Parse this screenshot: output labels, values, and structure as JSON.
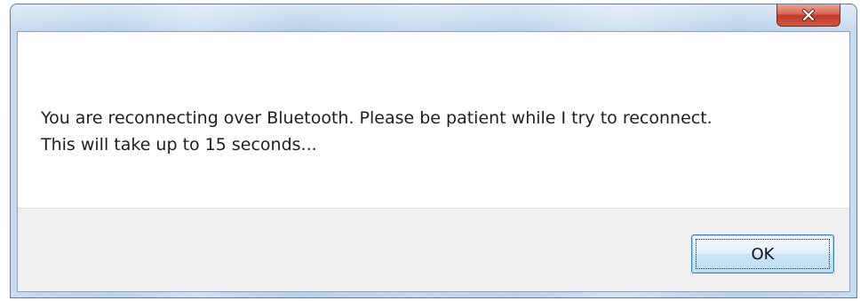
{
  "dialog": {
    "message_line1": "You are reconnecting over Bluetooth. Please be patient while I try to reconnect.",
    "message_line2": "This will take up to 15 seconds...",
    "ok_label": "OK"
  },
  "titlebar": {
    "close_icon": "close-icon"
  },
  "colors": {
    "close_button": "#c9402f",
    "ok_border": "#3c7fb1",
    "footer_background": "#f0f0f0"
  }
}
